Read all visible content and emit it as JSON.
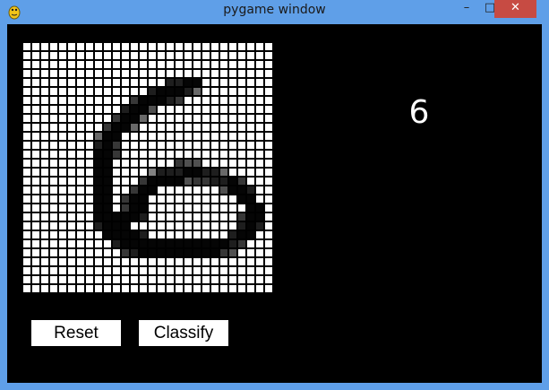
{
  "window": {
    "title": "pygame window",
    "controls": {
      "minimize": "–",
      "maximize": "□",
      "close": "✕"
    }
  },
  "app_icon": "pygame-snake-icon",
  "canvas": {
    "rows": 28,
    "cols": 28,
    "empty_color": "#ffffff",
    "grid_line_color": "#000000",
    "pixels": [
      "............................",
      "............................",
      "............................",
      "............................",
      "................8899........",
      "..............899985........",
      "............799987..........",
      "...........8996.............",
      "..........7995...............",
      ".........7995................",
      "........599..................",
      "........897..................",
      "........997..................",
      "........99.......766.........",
      "........99....488899885......",
      "........99...799996778897....",
      "........99..799.......6998...",
      "........99.799..........99...",
      "........99.799...........99..",
      "........999998..........799..",
      "........8999............898..",
      ".........99998.........899...",
      "..........899999999999987....",
      "...........7899999999976.....",
      "............................",
      "............................",
      "............................",
      "............................"
    ]
  },
  "buttons": {
    "reset": "Reset",
    "classify": "Classify"
  },
  "prediction": "6"
}
